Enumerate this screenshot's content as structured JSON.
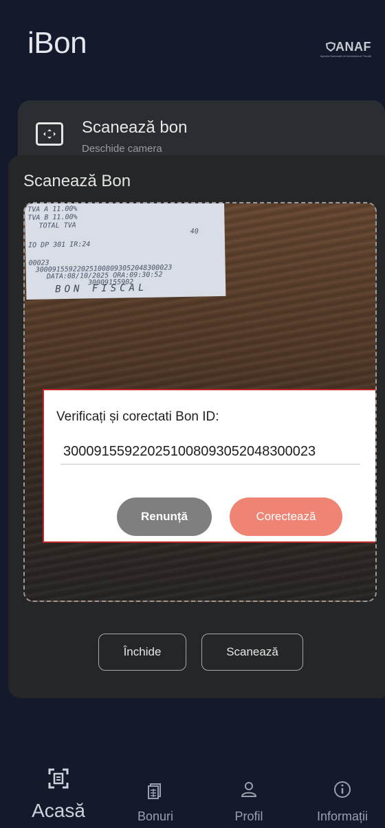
{
  "app": {
    "title": "iBon",
    "logo_text": "ANAF",
    "logo_subtext": "Agenția Națională de Administrare Fiscală"
  },
  "scan_card": {
    "title": "Scanează bon",
    "subtitle": "Deschide camera",
    "icon": "scan-frame-icon"
  },
  "sheet": {
    "title": "Scanează Bon",
    "close_label": "Închide",
    "scan_label": "Scanează"
  },
  "receipt": {
    "lines": [
      "TVA A  11.00%",
      "TVA B  11.00%",
      "TOTAL TVA",
      "40",
      "IO DP 301 IR:24",
      "00023",
      "300091559220251008093052048300023",
      "DATA:08/10/2025  ORA:09:30:52",
      "30009155902"
    ],
    "fiscal": "BON FISCAL"
  },
  "dialog": {
    "title": "Verificați și corectati Bon ID:",
    "value": "300091559220251008093052048300023",
    "cancel_label": "Renunță",
    "confirm_label": "Corectează"
  },
  "nav": {
    "items": [
      {
        "label": "Acasă",
        "icon": "scan-home-icon",
        "active": true
      },
      {
        "label": "Bonuri",
        "icon": "receipts-icon",
        "active": false
      },
      {
        "label": "Profil",
        "icon": "profile-icon",
        "active": false
      },
      {
        "label": "Informații",
        "icon": "info-icon",
        "active": false
      }
    ]
  },
  "colors": {
    "background": "#141a2b",
    "sheet": "#252628",
    "confirm": "#ef8474",
    "cancel": "#7f7f7f",
    "dialog_border": "#c0262a"
  }
}
